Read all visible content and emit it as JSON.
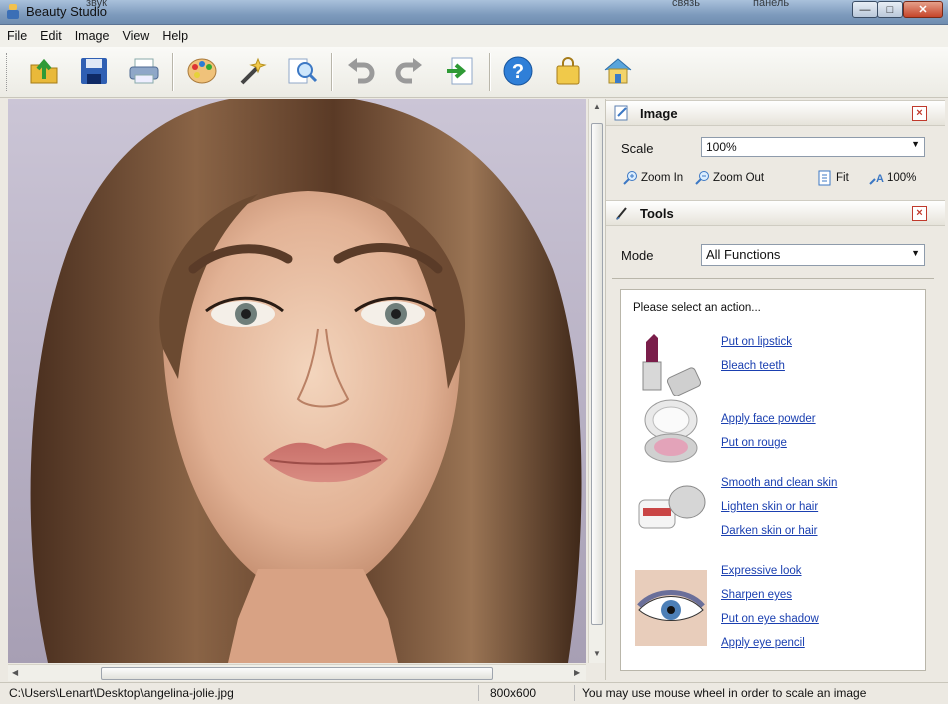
{
  "window": {
    "title": "Beauty Studio",
    "background_labels": [
      "звук",
      "связь",
      "панель"
    ]
  },
  "menu": [
    "File",
    "Edit",
    "Image",
    "View",
    "Help"
  ],
  "toolbar": {
    "buttons": [
      "open-icon",
      "save-icon",
      "print-icon",
      "palette-icon",
      "magic-wand-icon",
      "zoom-icon",
      "undo-icon",
      "redo-icon",
      "export-icon",
      "help-icon",
      "shop-bag-icon",
      "home-icon"
    ]
  },
  "image_panel": {
    "title": "Image",
    "scale_label": "Scale",
    "scale_value": "100%",
    "zoom_in": "Zoom In",
    "zoom_out": "Zoom Out",
    "fit": "Fit",
    "actual": "100%"
  },
  "tools_panel": {
    "title": "Tools",
    "mode_label": "Mode",
    "mode_value": "All Functions",
    "hint": "Please select an action...",
    "groups": [
      {
        "icon": "lipstick-icon",
        "links": [
          "Put on lipstick",
          "Bleach teeth"
        ]
      },
      {
        "icon": "compact-powder-icon",
        "links": [
          "Apply face powder",
          "Put on rouge"
        ]
      },
      {
        "icon": "cream-jar-icon",
        "links": [
          "Smooth and clean skin",
          "Lighten skin or hair",
          "Darken skin or hair"
        ]
      },
      {
        "icon": "eye-icon",
        "links": [
          "Expressive look",
          "Sharpen eyes",
          "Put on eye shadow",
          "Apply eye pencil"
        ]
      }
    ]
  },
  "status": {
    "path": "C:\\Users\\Lenart\\Desktop\\angelina-jolie.jpg",
    "dimensions": "800x600",
    "tip": "You may use mouse wheel in order to scale an image"
  },
  "colors": {
    "accent": "#1a3fb0",
    "close_red": "#c0392b",
    "titlebar": "#7e9bbd"
  }
}
